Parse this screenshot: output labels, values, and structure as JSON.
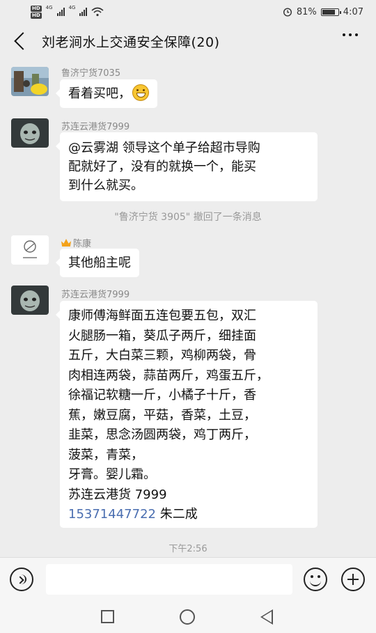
{
  "status_bar": {
    "hd_1": "HD",
    "hd_2": "HD",
    "net_1": "4G",
    "net_2": "4G",
    "battery": "81%",
    "time": "4:07"
  },
  "header": {
    "title": "刘老涧水上交通安全保障(20)"
  },
  "messages": [
    {
      "sender": "鲁济宁货7035",
      "lines": [
        "看着买吧，"
      ],
      "emoji": "grin-icon"
    },
    {
      "sender": "苏连云港货7999",
      "lines": [
        "@云雾湖  领导这个单子给超市导购",
        "配就好了，没有的就换一个，能买",
        "到什么就买。"
      ]
    },
    {
      "sender": "陈康",
      "lines": [
        "其他船主呢"
      ]
    },
    {
      "sender": "苏连云港货7999",
      "lines": [
        "康师傅海鲜面五连包要五包，双汇",
        "火腿肠一箱，葵瓜子两斤，细挂面",
        "五斤，大白菜三颗，鸡柳两袋，骨",
        "肉相连两袋，蒜苗两斤，鸡蛋五斤，",
        "徐福记软糖一斤，小橘子十斤，香",
        "蕉，嫩豆腐，平菇，香菜，土豆，",
        "韭菜，思念汤圆两袋，鸡丁两斤，",
        "菠菜，青菜，",
        "牙膏。婴儿霜。",
        "苏连云港货 7999"
      ],
      "phone": "15371447722",
      "phone_suffix": " 朱二成"
    }
  ],
  "system_note": "\"鲁济宁货 3905\" 撤回了一条消息",
  "time_stamp": "下午2:56"
}
